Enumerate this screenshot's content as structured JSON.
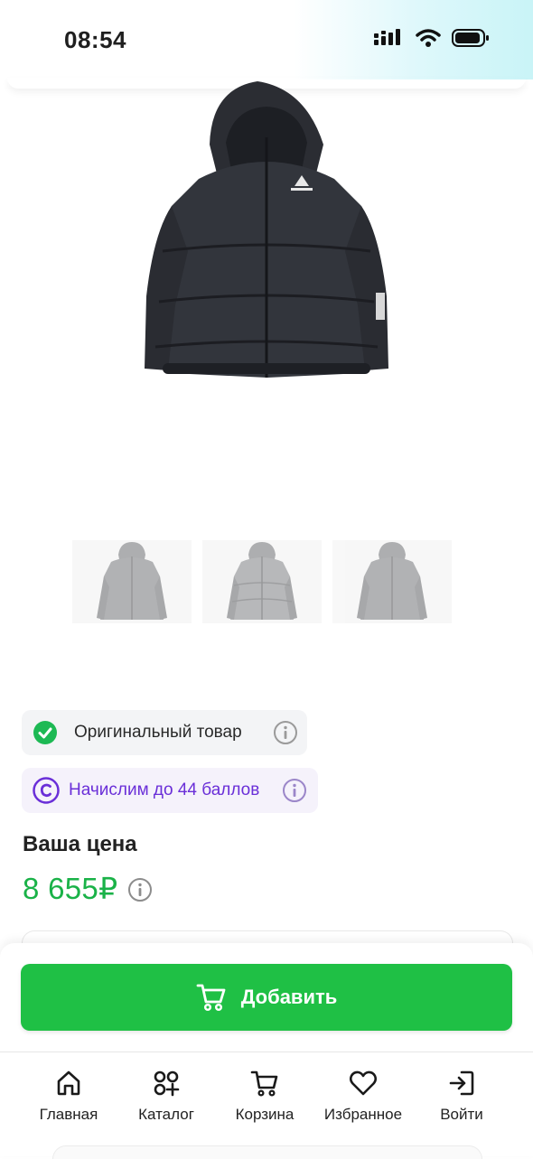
{
  "status_bar": {
    "time": "08:54"
  },
  "product": {
    "main_image_icon": "black-puffer-jacket-image",
    "thumbnails": [
      "jacket-thumbnail-1",
      "jacket-thumbnail-2",
      "jacket-thumbnail-3"
    ],
    "badges": {
      "original": "Оригинальный товар",
      "points": "Начислим до 44 баллов"
    },
    "price_label": "Ваша цена",
    "price": "8 655₽"
  },
  "actions": {
    "add_label": "Добавить"
  },
  "nav": {
    "items": [
      {
        "label": "Главная",
        "icon": "home-icon"
      },
      {
        "label": "Каталог",
        "icon": "catalog-icon"
      },
      {
        "label": "Корзина",
        "icon": "cart-icon"
      },
      {
        "label": "Избранное",
        "icon": "heart-icon"
      },
      {
        "label": "Войти",
        "icon": "login-icon"
      }
    ]
  },
  "colors": {
    "accent_green": "#1fc045",
    "price_green": "#1ab248",
    "points_purple": "#6a2fd8",
    "check_green": "#1db954"
  }
}
